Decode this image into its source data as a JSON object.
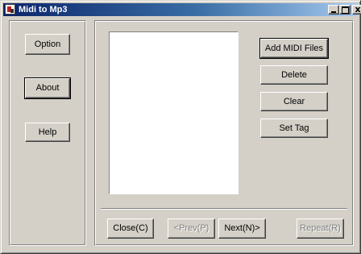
{
  "window": {
    "title": "Midi to Mp3",
    "close_glyph": "x"
  },
  "sidebar": {
    "option_label": "Option",
    "about_label": "About",
    "help_label": "Help"
  },
  "actions": {
    "add_midi_label": "Add MIDI Files",
    "delete_label": "Delete",
    "clear_label": "Clear",
    "set_tag_label": "Set Tag"
  },
  "footer": {
    "close_label": "Close(C)",
    "prev_label": "<Prev(P)",
    "next_label": "Next(N)>",
    "repeat_label": "Repeat(R)"
  },
  "file_list": {
    "items": []
  },
  "colors": {
    "face": "#d4d0c8",
    "title_start": "#0a246a",
    "title_end": "#a6caf0",
    "list_background": "#ffffff",
    "disabled_text": "#808080"
  }
}
